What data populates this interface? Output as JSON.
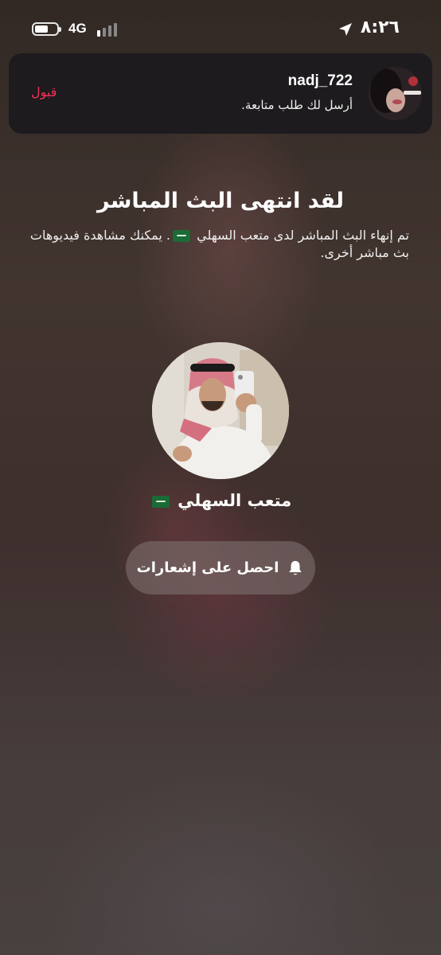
{
  "status_bar": {
    "time": "٨:٢٦",
    "network": "4G",
    "battery_level": 0.6,
    "signal_bars_active": 1,
    "icons": [
      "battery-icon",
      "signal-icon",
      "location-arrow-icon"
    ]
  },
  "notification": {
    "username": "nadj_722",
    "message": "أرسل لك طلب متابعة.",
    "accept_label": "قبول",
    "accept_color": "#f0325a"
  },
  "live_ended": {
    "title": "لقد انتهى البث المباشر",
    "desc_part1": "تم إنهاء البث المباشر لدى متعب السهلي",
    "desc_part2": ". يمكنك مشاهدة فيديوهات بث مباشر أخرى.",
    "host_name": "متعب السهلي",
    "notify_label": "احصل على إشعارات",
    "notify_icon": "bell-icon",
    "flag_icon": "saudi-flag-icon"
  }
}
